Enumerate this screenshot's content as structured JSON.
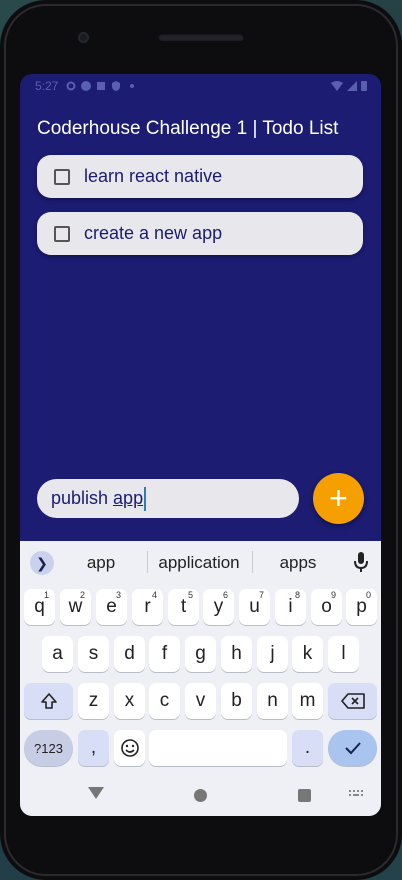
{
  "status_bar": {
    "time": "5:27"
  },
  "app": {
    "title": "Coderhouse Challenge 1 | Todo List"
  },
  "todos": [
    {
      "label": "learn react native",
      "checked": false
    },
    {
      "label": "create a new app",
      "checked": false
    }
  ],
  "input": {
    "prefix": "publish ",
    "composing": "app"
  },
  "add_button": {
    "label": "+"
  },
  "colors": {
    "background": "#1b1c72",
    "accent": "#f5a000",
    "item_bg": "#e8e8ec"
  },
  "keyboard": {
    "suggestions": [
      "app",
      "application",
      "apps"
    ],
    "row1": [
      {
        "k": "q",
        "s": "1"
      },
      {
        "k": "w",
        "s": "2"
      },
      {
        "k": "e",
        "s": "3"
      },
      {
        "k": "r",
        "s": "4"
      },
      {
        "k": "t",
        "s": "5"
      },
      {
        "k": "y",
        "s": "6"
      },
      {
        "k": "u",
        "s": "7"
      },
      {
        "k": "i",
        "s": "8"
      },
      {
        "k": "o",
        "s": "9"
      },
      {
        "k": "p",
        "s": "0"
      }
    ],
    "row2": [
      "a",
      "s",
      "d",
      "f",
      "g",
      "h",
      "j",
      "k",
      "l"
    ],
    "row3": [
      "z",
      "x",
      "c",
      "v",
      "b",
      "n",
      "m"
    ],
    "symbols_key": "?123",
    "comma_key": ",",
    "period_key": "."
  }
}
